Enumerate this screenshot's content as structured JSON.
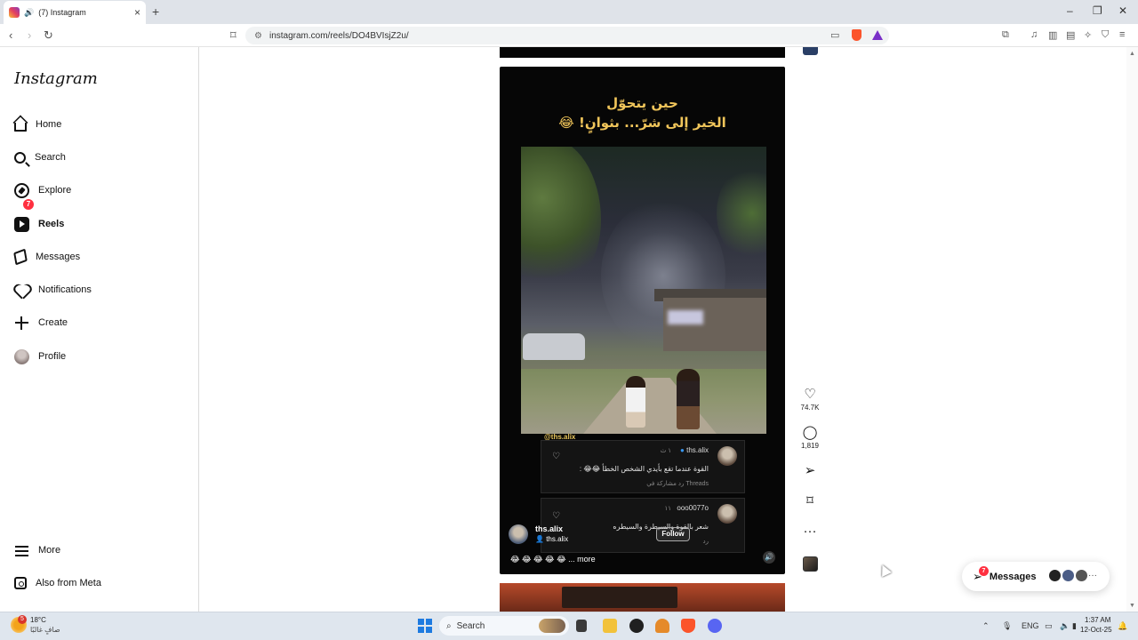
{
  "browser": {
    "tab_title": "(7) Instagram",
    "new_tab": "+",
    "url": "instagram.com/reels/DO4BVIsjZ2u/",
    "window_controls": {
      "minimize": "–",
      "restore": "❐",
      "close": "✕"
    }
  },
  "sidebar": {
    "logo": "Instagram",
    "items": [
      {
        "label": "Home",
        "icon": "home-icon"
      },
      {
        "label": "Search",
        "icon": "search-icon"
      },
      {
        "label": "Explore",
        "icon": "compass-icon"
      },
      {
        "label": "Reels",
        "icon": "reels-icon",
        "active": true
      },
      {
        "label": "Messages",
        "icon": "send-icon",
        "badge": "7"
      },
      {
        "label": "Notifications",
        "icon": "heart-icon"
      },
      {
        "label": "Create",
        "icon": "plus-icon"
      },
      {
        "label": "Profile",
        "icon": "avatar-icon"
      }
    ],
    "bottom": [
      {
        "label": "More",
        "icon": "menu-icon"
      },
      {
        "label": "Also from Meta",
        "icon": "meta-icon"
      }
    ]
  },
  "reel": {
    "caption_line1": "حين يتحوّل",
    "caption_line2": "الخير إلى شرّ... بثوانٍ! 😂",
    "watermark": "@ths.alix",
    "comments": [
      {
        "user": "ths.alix",
        "time": "١ ث",
        "text": "القوة عندما تقع بأيدي الشخص الخطأ 😂😂 :",
        "meta": "رد    مشاركة في Threads"
      },
      {
        "user": "ooo0077o",
        "time": "١١",
        "text": "شعر بالقوة والسيطرة والسيطره",
        "meta": "رد"
      }
    ],
    "owner": "ths.alix",
    "owner_sub": "ths.alix",
    "follow": "Follow",
    "caption": "😂 😂 😂 😂 😂 ... more",
    "likes": "74.7K",
    "comments_count": "1,819"
  },
  "messages_pill": {
    "label": "Messages",
    "badge": "7"
  },
  "taskbar": {
    "temperature": "18°C",
    "weather": "صافٍ غالبًا",
    "weather_badge": "5",
    "search": "Search",
    "lang": "ENG",
    "time": "1:37 AM",
    "date": "12-Oct-25"
  },
  "colors": {
    "accent_badge": "#ff3040",
    "caption_gold": "#f0c55a",
    "brave": "#fb542b"
  }
}
